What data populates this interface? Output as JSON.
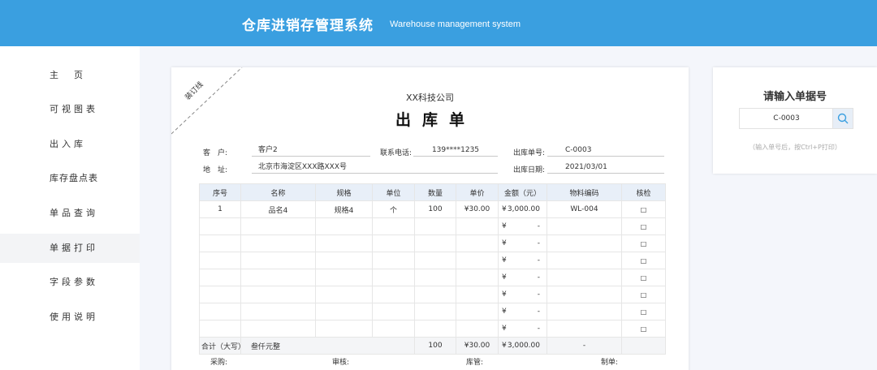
{
  "header": {
    "title": "仓库进销存管理系统",
    "subtitle": "Warehouse management system"
  },
  "sidebar": {
    "items": [
      {
        "label": "主　页"
      },
      {
        "label": "可视图表"
      },
      {
        "label": "出入库"
      },
      {
        "label": "库存盘点表"
      },
      {
        "label": "单品查询"
      },
      {
        "label": "单据打印"
      },
      {
        "label": "字段参数"
      },
      {
        "label": "使用说明"
      }
    ],
    "active_index": 5
  },
  "document": {
    "corner_label": "装订线",
    "company": "XX科技公司",
    "title": "出库单",
    "fields": {
      "customer_label": "客　户:",
      "customer": "客户2",
      "phone_label": "联系电话:",
      "phone": "139****1235",
      "order_no_label": "出库单号:",
      "order_no": "C-0003",
      "address_label": "地　址:",
      "address": "北京市海淀区XXX路XXX号",
      "date_label": "出库日期:",
      "date": "2021/03/01"
    },
    "table": {
      "headers": [
        "序号",
        "名称",
        "规格",
        "单位",
        "数量",
        "单价",
        "金额（元）",
        "物料编码",
        "核检"
      ],
      "currency": "¥",
      "rows": [
        [
          "1",
          "品名4",
          "规格4",
          "个",
          "100",
          "¥30.00",
          "3,000.00",
          "WL-004",
          "□"
        ],
        [
          "",
          "",
          "",
          "",
          "",
          "",
          "-",
          "",
          "□"
        ],
        [
          "",
          "",
          "",
          "",
          "",
          "",
          "-",
          "",
          "□"
        ],
        [
          "",
          "",
          "",
          "",
          "",
          "",
          "-",
          "",
          "□"
        ],
        [
          "",
          "",
          "",
          "",
          "",
          "",
          "-",
          "",
          "□"
        ],
        [
          "",
          "",
          "",
          "",
          "",
          "",
          "-",
          "",
          "□"
        ],
        [
          "",
          "",
          "",
          "",
          "",
          "",
          "-",
          "",
          "□"
        ],
        [
          "",
          "",
          "",
          "",
          "",
          "",
          "-",
          "",
          "□"
        ]
      ],
      "total": {
        "label": "合计（大写）",
        "amount_words": "叁仟元整",
        "quantity": "100",
        "price": "¥30.00",
        "amount": "3,000.00",
        "code": "-"
      }
    },
    "signatures": [
      "采购:",
      "审核:",
      "库管:",
      "制单:"
    ]
  },
  "search_panel": {
    "title": "请输入单据号",
    "value": "C-0003",
    "hint": "（输入单号后，按Ctrl+P打印）"
  },
  "colors": {
    "header_bg": "#3a9fe0",
    "table_header_bg": "#e8eff8"
  }
}
